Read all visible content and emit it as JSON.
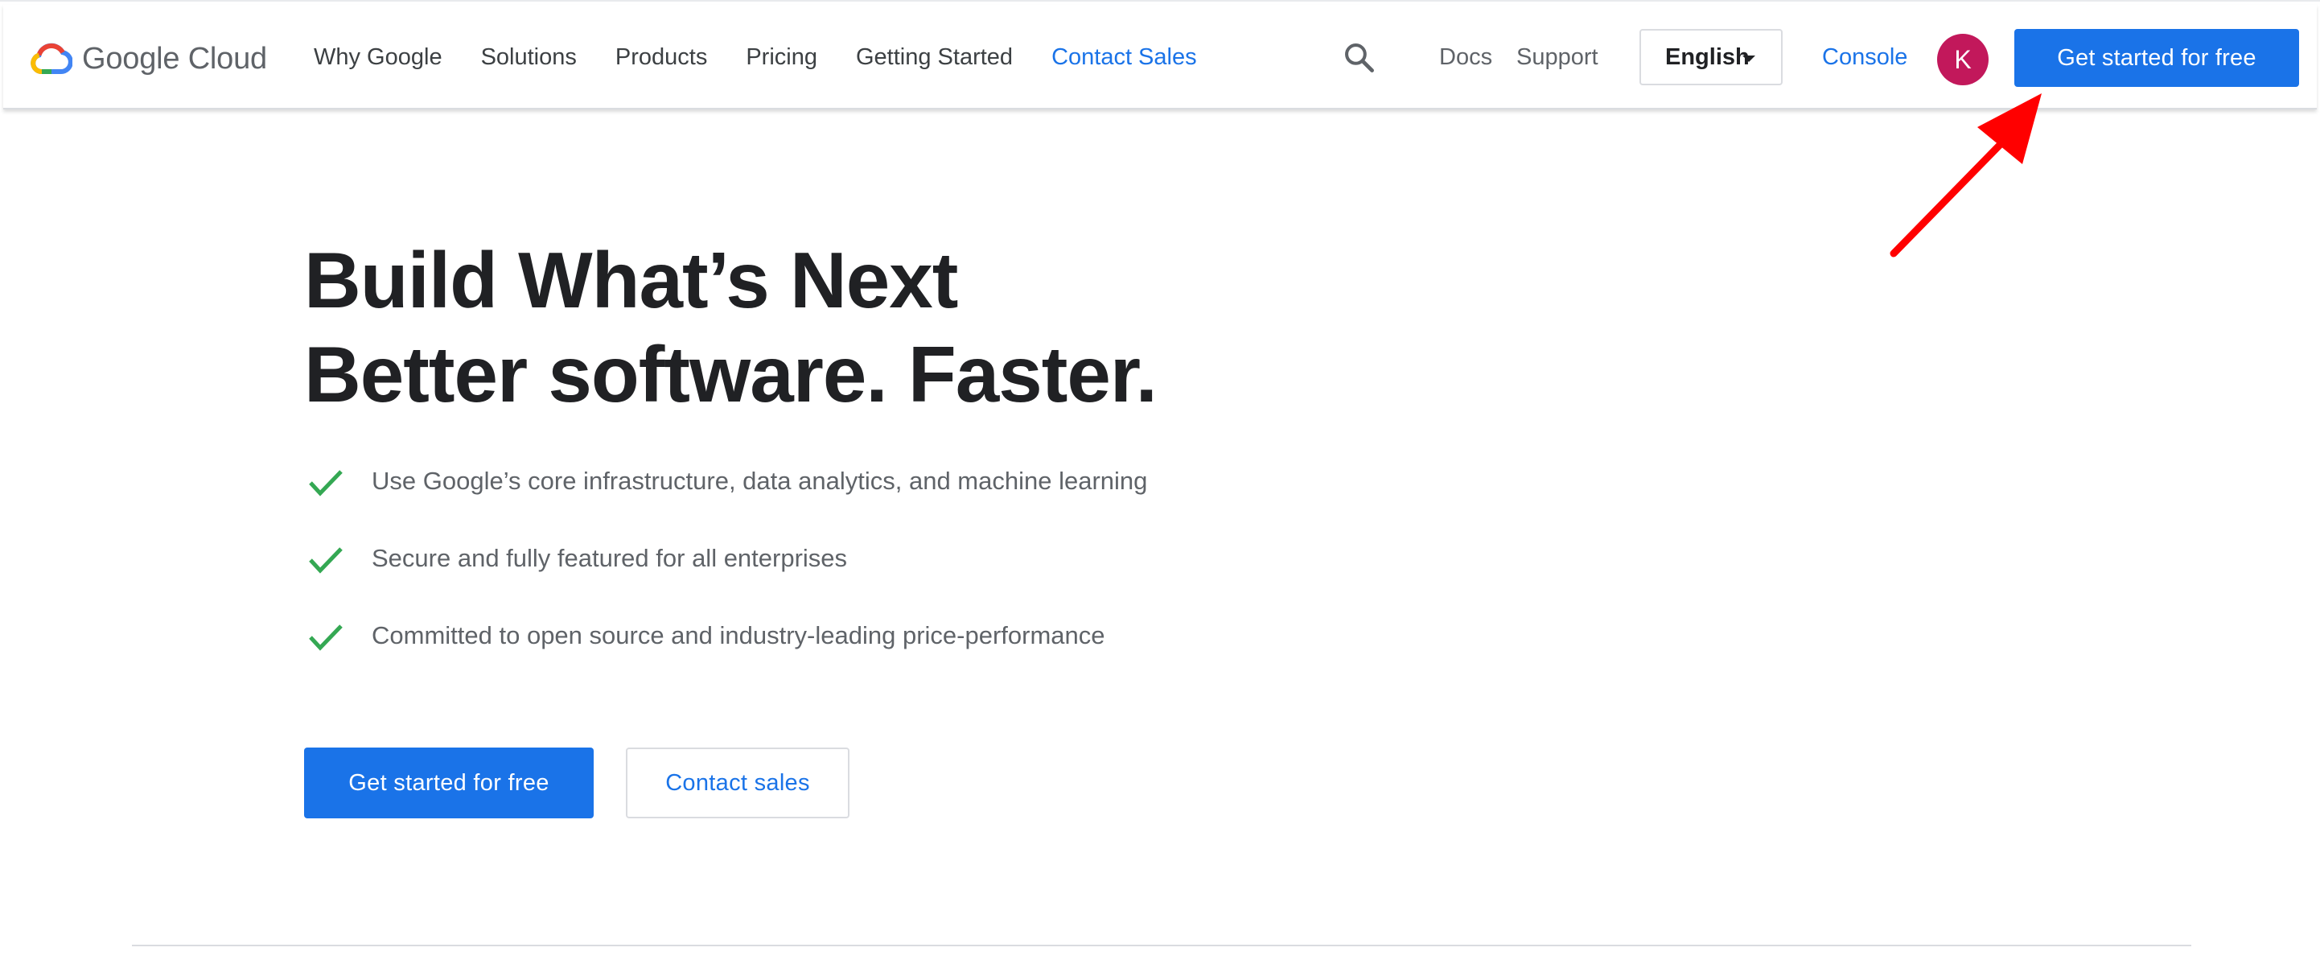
{
  "header": {
    "logo_text": "Google Cloud",
    "nav": [
      {
        "label": "Why Google"
      },
      {
        "label": "Solutions"
      },
      {
        "label": "Products"
      },
      {
        "label": "Pricing"
      },
      {
        "label": "Getting Started"
      },
      {
        "label": "Contact Sales",
        "active": true
      }
    ],
    "search_icon": "search-icon",
    "docs_label": "Docs",
    "support_label": "Support",
    "language": {
      "selected": "English"
    },
    "console_label": "Console",
    "avatar_initial": "K",
    "cta_label": "Get started for free"
  },
  "hero": {
    "title_line1": "Build What’s Next",
    "title_line2": "Better software. Faster.",
    "features": [
      {
        "text": "Use Google’s core infrastructure, data analytics, and machine learning"
      },
      {
        "text": "Secure and fully featured for all enterprises"
      },
      {
        "text": "Committed to open source and industry-leading price-performance"
      }
    ],
    "primary_button": "Get started for free",
    "secondary_button": "Contact sales"
  },
  "annotation": {
    "arrow_color": "#ff0000",
    "arrow_target": "get-started-top-button"
  },
  "colors": {
    "accent": "#1a73e8",
    "check": "#34a853",
    "avatar": "#c2185b"
  }
}
